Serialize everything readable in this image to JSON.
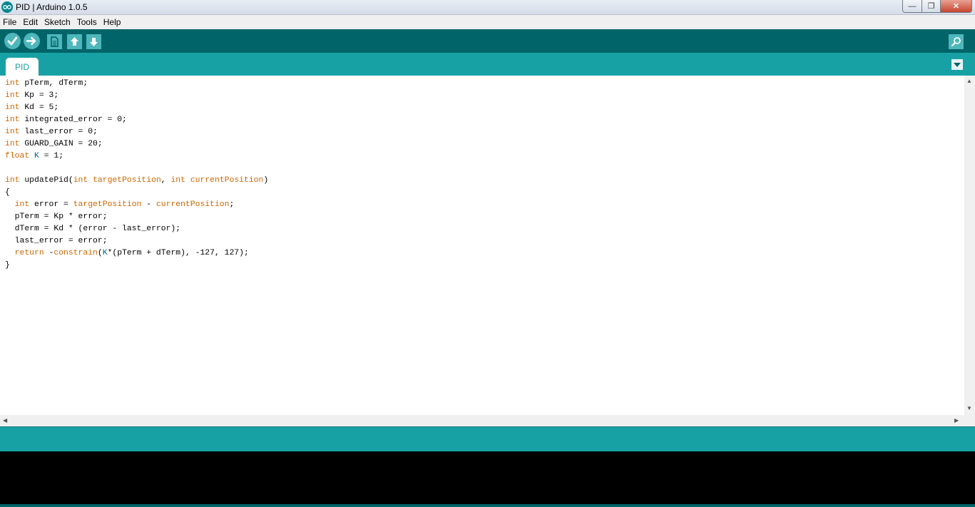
{
  "window": {
    "title": "PID | Arduino 1.0.5",
    "minimize_glyph": "—",
    "maximize_glyph": "❐",
    "close_glyph": "✕"
  },
  "menu": {
    "items": [
      "File",
      "Edit",
      "Sketch",
      "Tools",
      "Help"
    ]
  },
  "toolbar": {
    "icons": [
      "verify-icon",
      "upload-icon",
      "new-icon",
      "open-icon",
      "save-icon",
      "serial-monitor-icon"
    ]
  },
  "tabs": {
    "items": [
      "PID"
    ]
  },
  "editor": {
    "lines": [
      [
        [
          "kw",
          "int"
        ],
        [
          "t",
          " pTerm, dTerm;"
        ]
      ],
      [
        [
          "kw",
          "int"
        ],
        [
          "t",
          " Kp = 3;"
        ]
      ],
      [
        [
          "kw",
          "int"
        ],
        [
          "t",
          " Kd = 5;"
        ]
      ],
      [
        [
          "kw",
          "int"
        ],
        [
          "t",
          " integrated_error = 0;"
        ]
      ],
      [
        [
          "kw",
          "int"
        ],
        [
          "t",
          " last_error = 0;"
        ]
      ],
      [
        [
          "kw",
          "int"
        ],
        [
          "t",
          " GUARD_GAIN = 20;"
        ]
      ],
      [
        [
          "kw",
          "float"
        ],
        [
          "t",
          " "
        ],
        [
          "id",
          "K"
        ],
        [
          "t",
          " = 1;"
        ]
      ],
      [
        [
          "t",
          ""
        ]
      ],
      [
        [
          "kw",
          "int"
        ],
        [
          "t",
          " updatePid("
        ],
        [
          "kw",
          "int"
        ],
        [
          "t",
          " "
        ],
        [
          "fn",
          "targetPosition"
        ],
        [
          "t",
          ", "
        ],
        [
          "kw",
          "int"
        ],
        [
          "t",
          " "
        ],
        [
          "fn",
          "currentPosition"
        ],
        [
          "t",
          ")"
        ]
      ],
      [
        [
          "t",
          "{"
        ]
      ],
      [
        [
          "t",
          "  "
        ],
        [
          "kw",
          "int"
        ],
        [
          "t",
          " error = "
        ],
        [
          "fn",
          "targetPosition"
        ],
        [
          "t",
          " - "
        ],
        [
          "fn",
          "currentPosition"
        ],
        [
          "t",
          ";"
        ]
      ],
      [
        [
          "t",
          "  pTerm = Kp * error;"
        ]
      ],
      [
        [
          "t",
          "  dTerm = Kd * (error - last_error);"
        ]
      ],
      [
        [
          "t",
          "  last_error = error;"
        ]
      ],
      [
        [
          "t",
          "  "
        ],
        [
          "kw",
          "return"
        ],
        [
          "t",
          " -"
        ],
        [
          "fn",
          "constrain"
        ],
        [
          "t",
          "("
        ],
        [
          "id",
          "K"
        ],
        [
          "t",
          "*(pTerm + dTerm), -127, 127);"
        ]
      ],
      [
        [
          "t",
          "}"
        ]
      ]
    ]
  },
  "colors": {
    "toolbar_bg": "#006468",
    "tabbar_bg": "#17a1a5",
    "keyword": "#cc6600",
    "identifier": "#006699",
    "console_bg": "#000000"
  }
}
